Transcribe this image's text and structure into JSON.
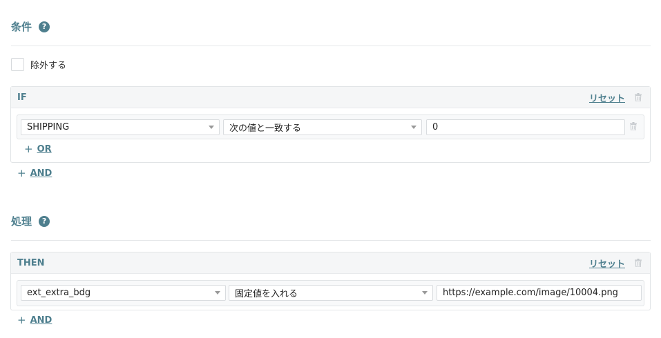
{
  "conditions": {
    "title": "条件",
    "help_glyph": "?",
    "exclude_label": "除外する",
    "if_panel": {
      "title": "IF",
      "reset_label": "リセット",
      "row": {
        "field_value": "SHIPPING",
        "operator_value": "次の値と一致する",
        "input_value": "0"
      },
      "or_label": "OR"
    },
    "and_label": "AND"
  },
  "actions": {
    "title": "処理",
    "help_glyph": "?",
    "then_panel": {
      "title": "THEN",
      "reset_label": "リセット",
      "row": {
        "field_value": "ext_extra_bdg",
        "operator_value": "固定値を入れる",
        "input_value": "https://example.com/image/10004.png"
      }
    },
    "and_label": "AND"
  },
  "glyphs": {
    "plus": "+"
  },
  "colors": {
    "accent": "#4e7f8e",
    "icon_gray": "#c4c8cc"
  }
}
